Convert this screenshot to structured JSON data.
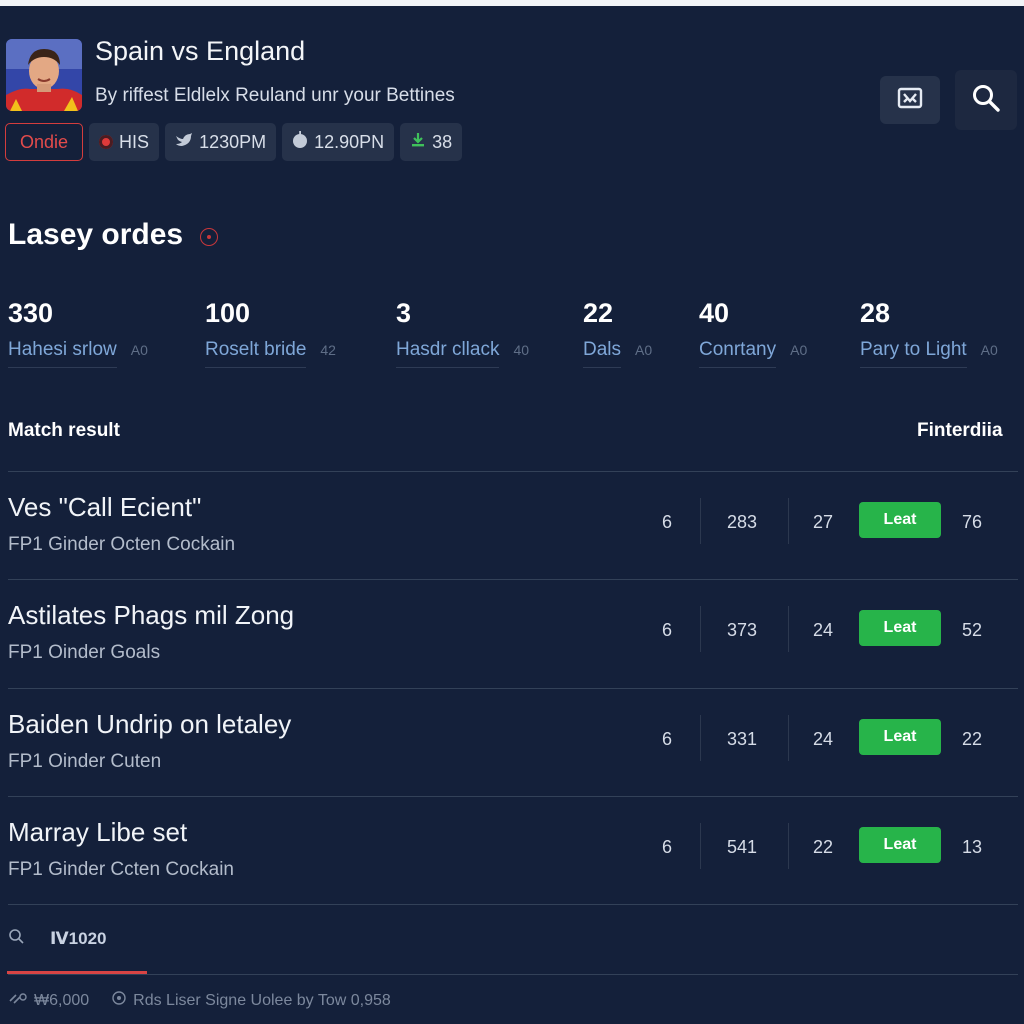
{
  "header": {
    "title": "Spain vs England",
    "subtitle": "By riffest Eldlelx Reuland unr your Bettines"
  },
  "chips": [
    {
      "label": "Ondie",
      "icon": "none"
    },
    {
      "label": "HIS",
      "icon": "red-dot-icon"
    },
    {
      "label": "1230PM",
      "icon": "bird-icon"
    },
    {
      "label": "12.90PN",
      "icon": "apple-icon"
    },
    {
      "label": "38",
      "icon": "download-icon"
    }
  ],
  "section": {
    "title": "Lasey ordes"
  },
  "stats": [
    {
      "value": "330",
      "label": "Hahesi srlow",
      "sub": "A0"
    },
    {
      "value": "100",
      "label": "Roselt bride",
      "sub": "42"
    },
    {
      "value": "3",
      "label": "Hasdr cllack",
      "sub": "40"
    },
    {
      "value": "22",
      "label": "Dals",
      "sub": "A0"
    },
    {
      "value": "40",
      "label": "Conrtany",
      "sub": "A0"
    },
    {
      "value": "28",
      "label": "Pary to Light",
      "sub": "A0"
    }
  ],
  "table": {
    "left_header": "Match result",
    "right_header": "Finterdiia",
    "button_label": "Leat",
    "rows": [
      {
        "name": "Ves \"Call Ecient\"",
        "meta": "FP1 Ginder Octen Cockain",
        "c1": "6",
        "c2": "283",
        "c3": "27",
        "c4": "76"
      },
      {
        "name": "Astilates Phags mil Zong",
        "meta": "FP1 Oinder Goals",
        "c1": "6",
        "c2": "373",
        "c3": "24",
        "c4": "52"
      },
      {
        "name": "Baiden Undrip on letaley",
        "meta": "FP1 Oinder Cuten",
        "c1": "6",
        "c2": "331",
        "c3": "24",
        "c4": "22"
      },
      {
        "name": "Marray Libe set",
        "meta": "FP1 Ginder Ccten Cockain",
        "c1": "6",
        "c2": "541",
        "c3": "22",
        "c4": "13"
      }
    ]
  },
  "bottom": {
    "tab_label": "Ⅳ1020",
    "footer_left": "₩6,000",
    "footer_right": "Rds Liser Signe Uolee by Tow 0,958"
  },
  "colors": {
    "background": "#14203a",
    "accent_red": "#d84444",
    "accent_green": "#27b44a",
    "label_blue": "#7fa7d8"
  }
}
